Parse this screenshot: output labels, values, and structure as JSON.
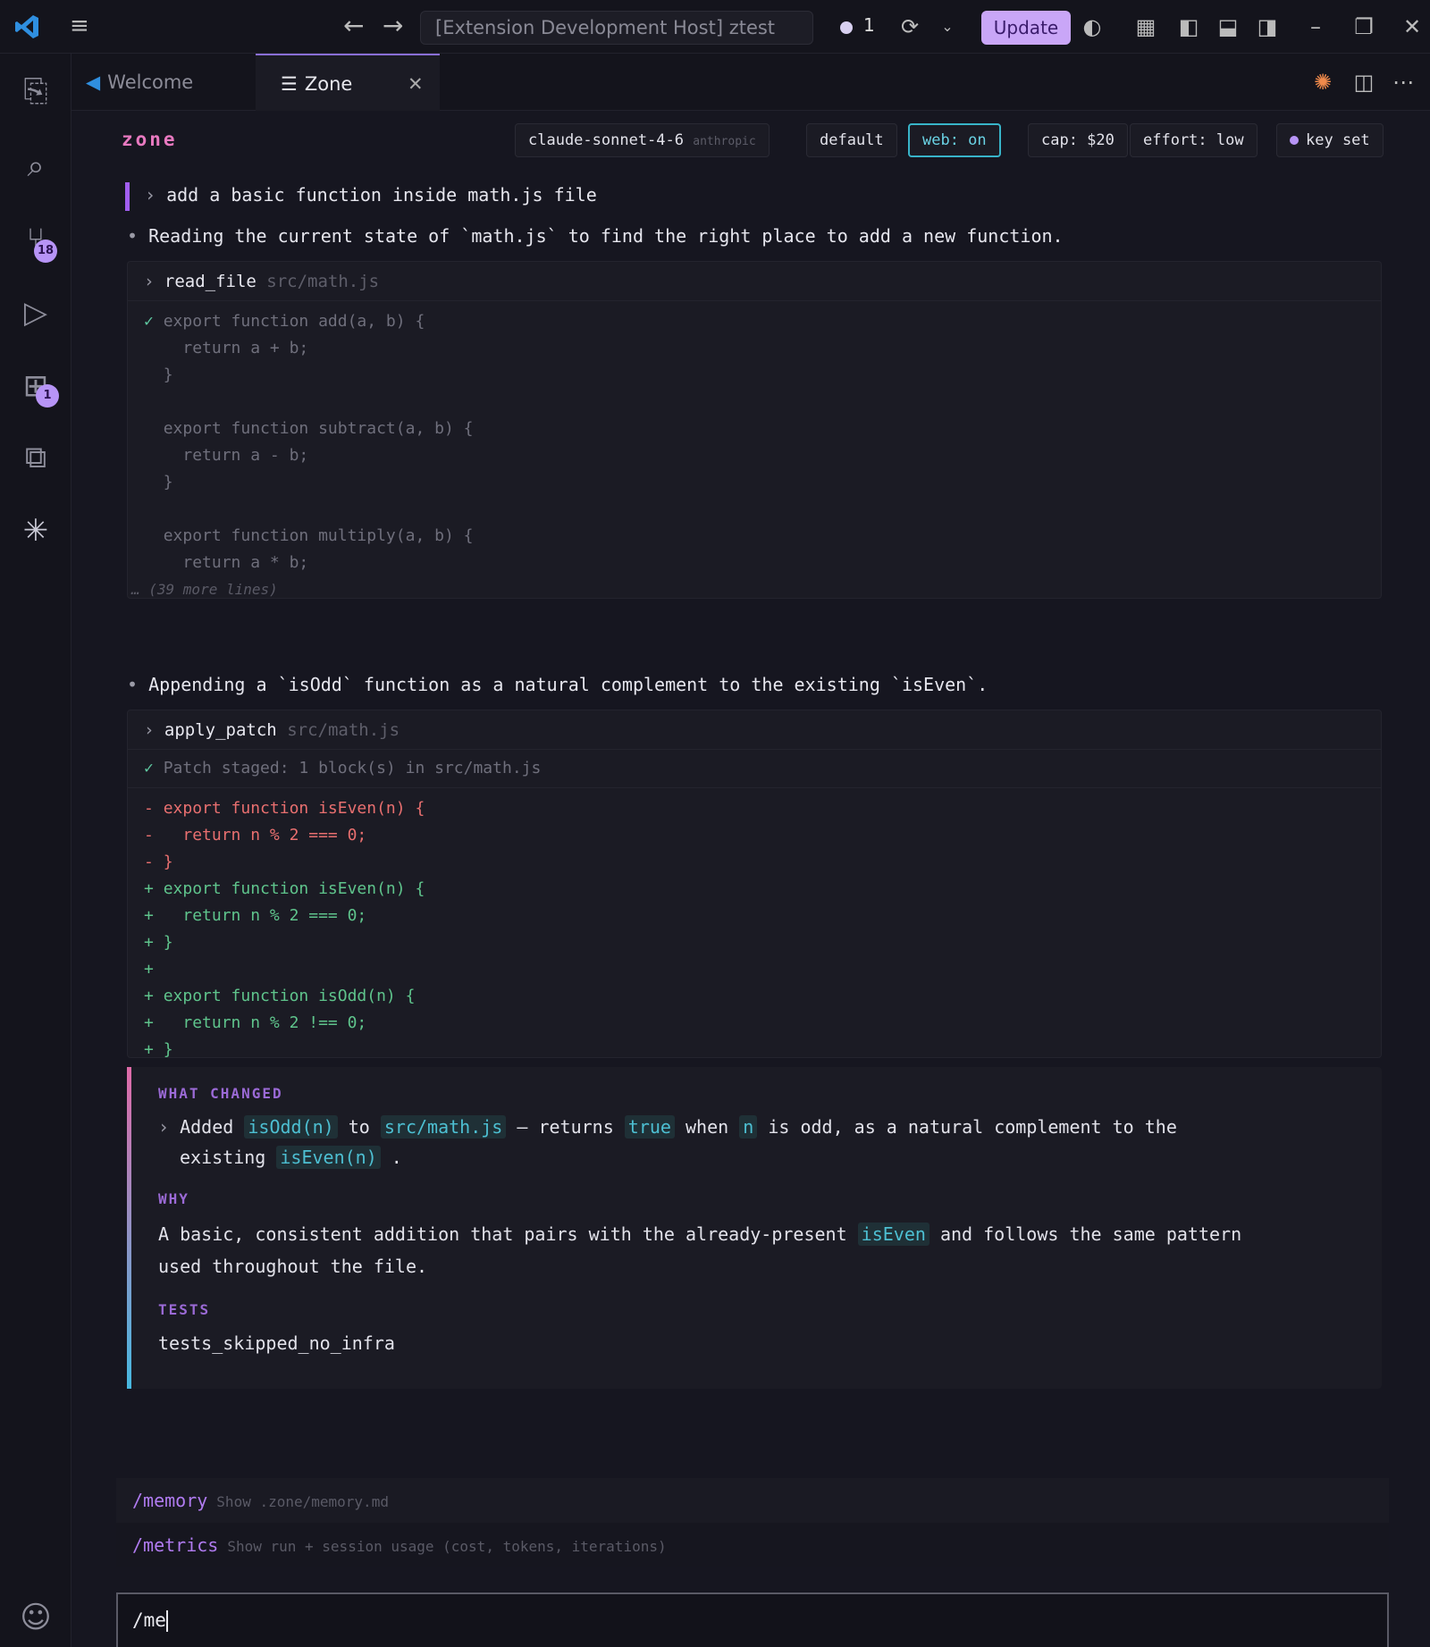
{
  "titlebar": {
    "search": "[Extension Development Host] ztest",
    "notification_count": "1",
    "update_label": "Update"
  },
  "activity": {
    "scm_badge": "18",
    "extensions_badge": "1"
  },
  "tabs": [
    {
      "label": "Welcome"
    },
    {
      "label": "Zone"
    }
  ],
  "header": {
    "brand": "zone",
    "model": "claude-sonnet-4-6",
    "provider": "anthropic",
    "mode": "default",
    "web": "web: on",
    "cap": "cap: $20",
    "effort": "effort: low",
    "key": "key set"
  },
  "chat": {
    "user_prompt": "add a basic function inside math.js file",
    "step1": "Reading the current state of `math.js` to find the right place to add a new function.",
    "read_tool": {
      "name": "read_file",
      "path": "src/math.js"
    },
    "read_lines": [
      "export function add(a, b) {",
      "  return a + b;",
      "}",
      "",
      "export function subtract(a, b) {",
      "  return a - b;",
      "}",
      "",
      "export function multiply(a, b) {",
      "  return a * b;"
    ],
    "read_more": "… (39 more lines)",
    "step2": "Appending a `isOdd` function as a natural complement to the existing `isEven`.",
    "patch_tool": {
      "name": "apply_patch",
      "path": "src/math.js"
    },
    "patch_status": "Patch staged: 1 block(s) in src/math.js",
    "diff": [
      {
        "sign": "-",
        "type": "del",
        "text": "export function isEven(n) {"
      },
      {
        "sign": "-",
        "type": "del",
        "text": "  return n % 2 === 0;"
      },
      {
        "sign": "-",
        "type": "del",
        "text": "}"
      },
      {
        "sign": "+",
        "type": "add",
        "text": "export function isEven(n) {"
      },
      {
        "sign": "+",
        "type": "add",
        "text": "  return n % 2 === 0;"
      },
      {
        "sign": "+",
        "type": "add",
        "text": "}"
      },
      {
        "sign": "+",
        "type": "add",
        "text": ""
      },
      {
        "sign": "+",
        "type": "add",
        "text": "export function isOdd(n) {"
      },
      {
        "sign": "+",
        "type": "add",
        "text": "  return n % 2 !== 0;"
      },
      {
        "sign": "+",
        "type": "add",
        "text": "}"
      }
    ]
  },
  "summary": {
    "what_label": "WHAT CHANGED",
    "what_added": "Added",
    "what_fn": "isOdd(n)",
    "what_to": "to",
    "what_file": "src/math.js",
    "what_returns": "— returns",
    "what_true": "true",
    "what_when": "when",
    "what_n": "n",
    "what_rest": "is odd, as a natural complement to the",
    "what_existing": "existing",
    "what_iseven": "isEven(n)",
    "what_period": ".",
    "why_label": "WHY",
    "why_pre": "A basic, consistent addition that pairs with the already-present",
    "why_chip": "isEven",
    "why_post": "and follows the same pattern",
    "why_line2": "used throughout the file.",
    "tests_label": "TESTS",
    "tests_value": "tests_skipped_no_infra"
  },
  "suggestions": [
    {
      "cmd": "/memory",
      "desc": "Show .zone/memory.md"
    },
    {
      "cmd": "/metrics",
      "desc": "Show run + session usage (cost, tokens, iterations)"
    }
  ],
  "input": {
    "value": "/me"
  },
  "colors": {
    "accent": "#b794f6",
    "brand": "#e879c0",
    "web_on": "#38b4c9",
    "update": "#c9a6f7"
  }
}
